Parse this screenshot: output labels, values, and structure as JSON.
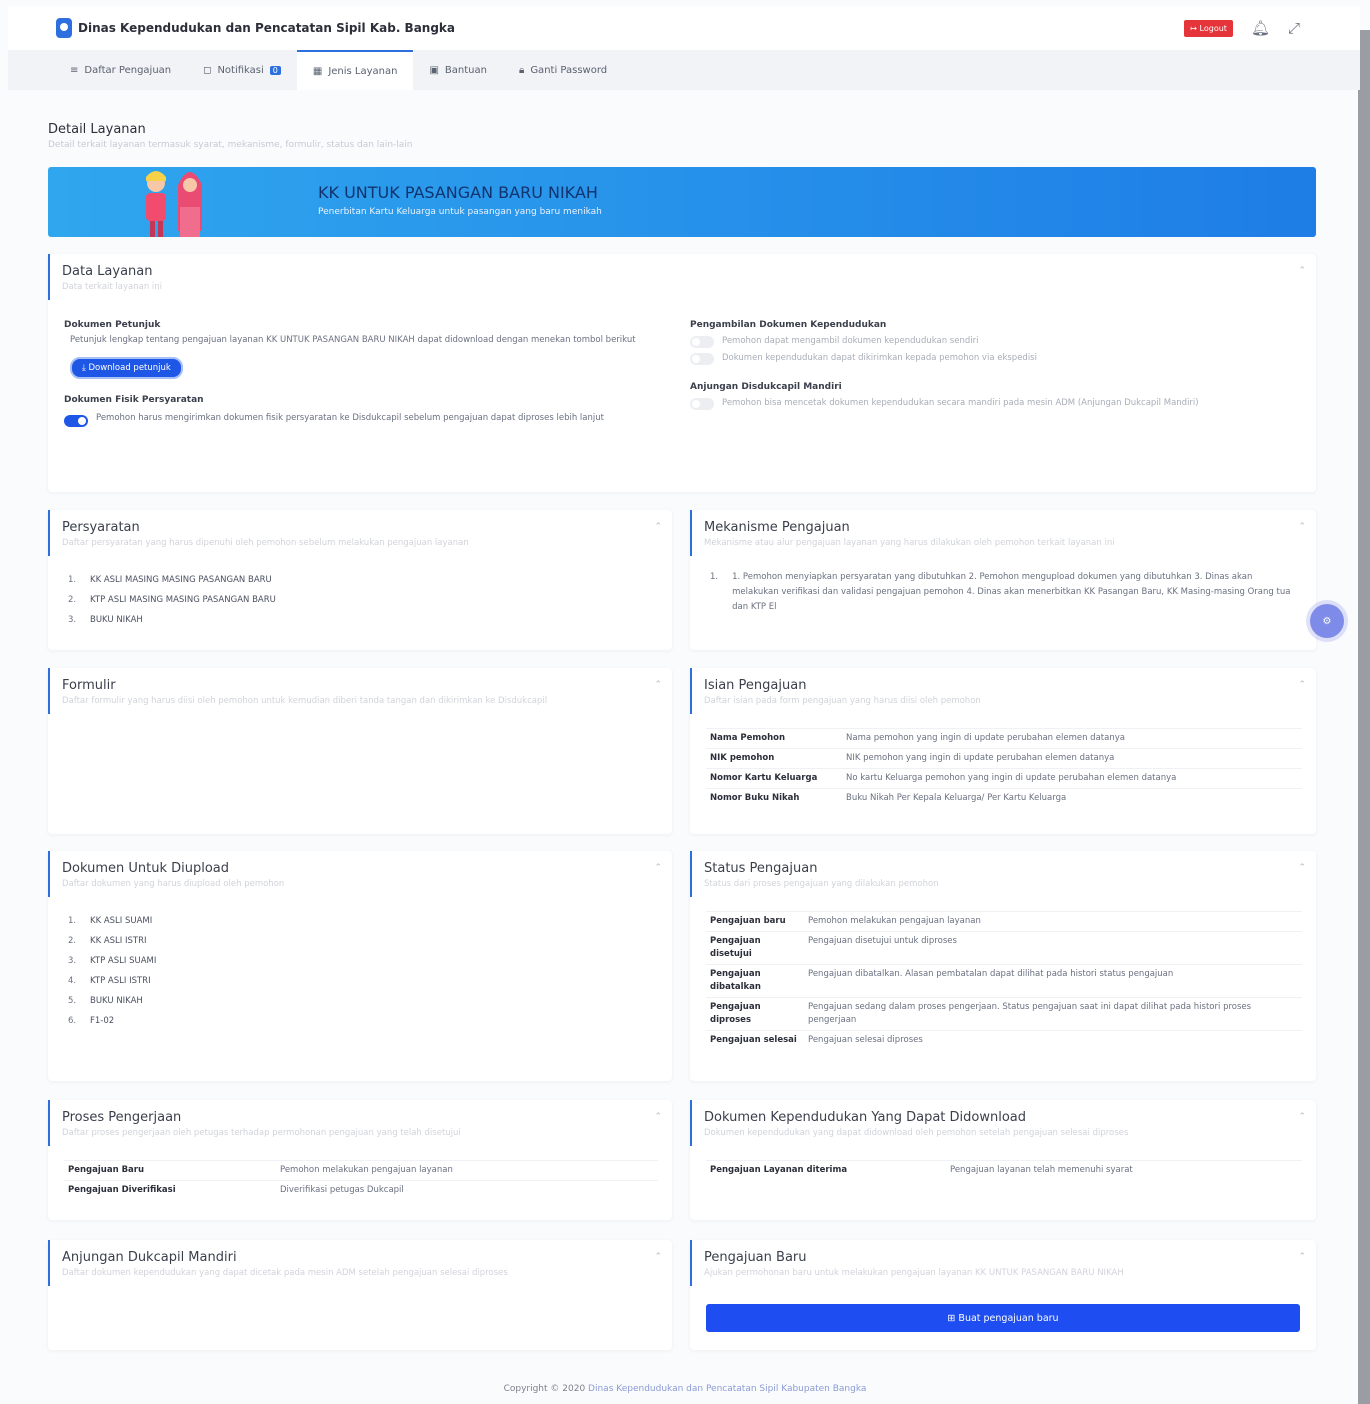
{
  "app": {
    "title": "Dinas Kependudukan dan Pencatatan Sipil Kab. Bangka",
    "logout": "Logout"
  },
  "nav": [
    {
      "label": "Daftar Pengajuan"
    },
    {
      "label": "Notifikasi",
      "badge": "0"
    },
    {
      "label": "Jenis Layanan"
    },
    {
      "label": "Bantuan"
    },
    {
      "label": "Ganti Password"
    }
  ],
  "page": {
    "title": "Detail Layanan",
    "subtitle": "Detail terkait layanan termasuk syarat, mekanisme, formulir, status dan lain-lain"
  },
  "hero": {
    "title": "KK UNTUK PASANGAN BARU NIKAH",
    "subtitle": "Penerbitan Kartu Keluarga untuk pasangan yang baru menikah"
  },
  "data_layanan": {
    "title": "Data Layanan",
    "subtitle": "Data terkait layanan ini",
    "petunjuk": {
      "label": "Dokumen Petunjuk",
      "text": "Petunjuk lengkap tentang pengajuan layanan KK UNTUK PASANGAN BARU NIKAH dapat didownload dengan menekan tombol berikut",
      "button": "Download petunjuk"
    },
    "fisik": {
      "label": "Dokumen Fisik Persyaratan",
      "text": "Pemohon harus mengirimkan dokumen fisik persyaratan ke Disdukcapil sebelum pengajuan dapat diproses lebih lanjut"
    },
    "pengambilan": {
      "label": "Pengambilan Dokumen Kependudukan",
      "opt1": "Pemohon dapat mengambil dokumen kependudukan sendiri",
      "opt2": "Dokumen kependudukan dapat dikirimkan kepada pemohon via ekspedisi"
    },
    "anjungan": {
      "label": "Anjungan Disdukcapil Mandiri",
      "opt1": "Pemohon bisa mencetak dokumen kependudukan secara mandiri pada mesin ADM (Anjungan Dukcapil Mandiri)"
    }
  },
  "persyaratan": {
    "title": "Persyaratan",
    "subtitle": "Daftar persyaratan yang harus dipenuhi oleh pemohon sebelum melakukan pengajuan layanan",
    "items": [
      "KK ASLI MASING MASING PASANGAN BARU",
      "KTP ASLI MASING MASING PASANGAN BARU",
      "BUKU NIKAH"
    ]
  },
  "mekanisme": {
    "title": "Mekanisme Pengajuan",
    "subtitle": "Mekanisme atau alur pengajuan layanan yang harus dilakukan oleh pemohon terkait layanan ini",
    "items": [
      "1. Pemohon menyiapkan persyaratan yang dibutuhkan 2. Pemohon mengupload dokumen yang dibutuhkan 3. Dinas akan melakukan verifikasi dan validasi pengajuan pemohon 4. Dinas akan menerbitkan KK Pasangan Baru, KK Masing-masing Orang tua dan KTP El"
    ]
  },
  "formulir": {
    "title": "Formulir",
    "subtitle": "Daftar formulir yang harus diisi oleh pemohon untuk kemudian diberi tanda tangan dan dikirimkan ke Disdukcapil"
  },
  "isian": {
    "title": "Isian Pengajuan",
    "subtitle": "Daftar isian pada form pengajuan yang harus diisi oleh pemohon",
    "rows": [
      {
        "k": "Nama Pemohon",
        "v": "Nama pemohon yang ingin di update perubahan elemen datanya"
      },
      {
        "k": "NIK pemohon",
        "v": "NIK pemohon yang ingin di update perubahan elemen datanya"
      },
      {
        "k": "Nomor Kartu Keluarga",
        "v": "No kartu Keluarga pemohon yang ingin di update perubahan elemen datanya"
      },
      {
        "k": "Nomor Buku Nikah",
        "v": "Buku Nikah Per Kepala Keluarga/ Per Kartu Keluarga"
      }
    ]
  },
  "upload": {
    "title": "Dokumen Untuk Diupload",
    "subtitle": "Daftar dokumen yang harus diupload oleh pemohon",
    "items": [
      "KK ASLI SUAMI",
      "KK ASLI ISTRI",
      "KTP ASLI SUAMI",
      "KTP ASLI ISTRI",
      "BUKU NIKAH",
      "F1-02"
    ]
  },
  "status": {
    "title": "Status Pengajuan",
    "subtitle": "Status dari proses pengajuan yang dilakukan pemohon",
    "rows": [
      {
        "k": "Pengajuan baru",
        "v": "Pemohon melakukan pengajuan layanan"
      },
      {
        "k": "Pengajuan disetujui",
        "v": "Pengajuan disetujui untuk diproses"
      },
      {
        "k": "Pengajuan dibatalkan",
        "v": "Pengajuan dibatalkan. Alasan pembatalan dapat dilihat pada histori status pengajuan"
      },
      {
        "k": "Pengajuan diproses",
        "v": "Pengajuan sedang dalam proses pengerjaan. Status pengajuan saat ini dapat dilihat pada histori proses pengerjaan"
      },
      {
        "k": "Pengajuan selesai",
        "v": "Pengajuan selesai diproses"
      }
    ]
  },
  "proses": {
    "title": "Proses Pengerjaan",
    "subtitle": "Daftar proses pengerjaan oleh petugas terhadap permohonan pengajuan yang telah disetujui",
    "rows": [
      {
        "k": "Pengajuan Baru",
        "v": "Pemohon melakukan pengajuan layanan"
      },
      {
        "k": "Pengajuan Diverifikasi",
        "v": "Diverifikasi petugas Dukcapil"
      }
    ]
  },
  "dokumen_download": {
    "title": "Dokumen Kependudukan Yang Dapat Didownload",
    "subtitle": "Dokumen kependudukan yang dapat didownload oleh pemohon setelah pengajuan selesai diproses",
    "rows": [
      {
        "k": "Pengajuan Layanan diterima",
        "v": "Pengajuan layanan telah memenuhi syarat"
      }
    ]
  },
  "anjungan_card": {
    "title": "Anjungan Dukcapil Mandiri",
    "subtitle": "Daftar dokumen kependudukan yang dapat dicetak pada mesin ADM setelah pengajuan selesai diproses"
  },
  "baru": {
    "title": "Pengajuan Baru",
    "subtitle": "Ajukan permohonan baru untuk melakukan pengajuan layanan KK UNTUK PASANGAN BARU NIKAH",
    "button": "Buat pengajuan baru"
  },
  "footer": {
    "prefix": "Copyright © 2020",
    "org": "Dinas Kependudukan dan Pencatatan Sipil Kabupaten Bangka"
  },
  "colors": {
    "primary": "#1e56e6",
    "danger": "#e5343a",
    "hero_start": "#2fa6ee",
    "hero_end": "#1e7de6"
  }
}
